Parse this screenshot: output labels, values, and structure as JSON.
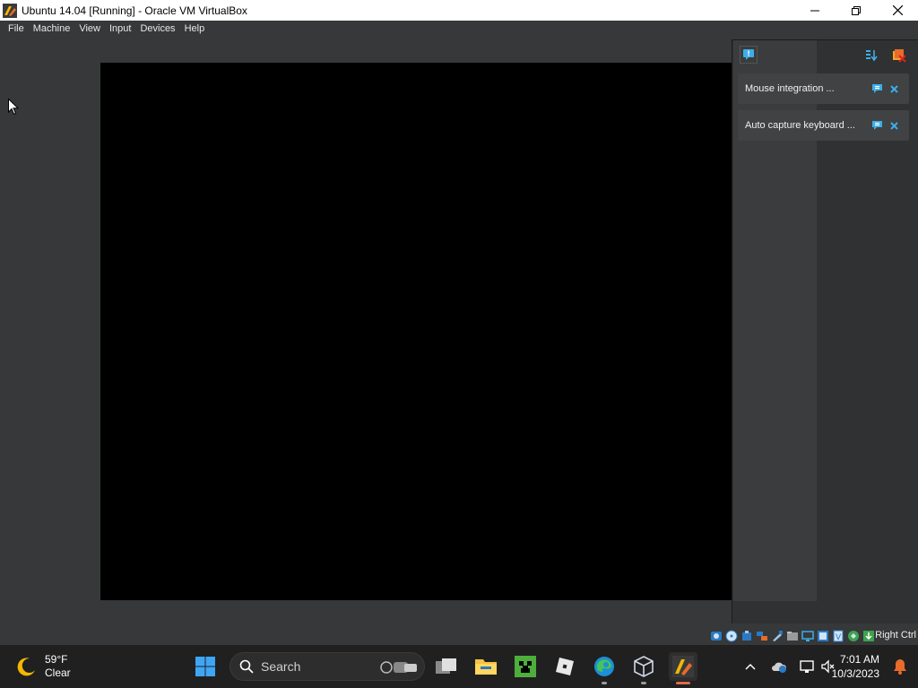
{
  "window": {
    "title": "Ubuntu 14.04 [Running] - Oracle VM VirtualBox",
    "controls": {
      "minimize": "minimize-icon",
      "maximize": "maximize-icon",
      "close": "close-icon"
    }
  },
  "menubar": {
    "items": [
      "File",
      "Machine",
      "View",
      "Input",
      "Devices",
      "Help"
    ]
  },
  "notifications": {
    "items": [
      {
        "text": "Mouse integration ..."
      },
      {
        "text": "Auto capture keyboard ..."
      }
    ]
  },
  "statusbar": {
    "host_key": "Right Ctrl",
    "icons": [
      "hard-disk-icon",
      "optical-drive-icon",
      "audio-icon",
      "network-icon",
      "usb-icon",
      "shared-folders-icon",
      "display-icon",
      "video-capture-icon",
      "mouse-integration-icon",
      "keyboard-icon",
      "arrow-down-icon"
    ]
  },
  "taskbar": {
    "weather": {
      "temp": "59°F",
      "condition": "Clear"
    },
    "search_placeholder": "Search",
    "apps": [
      "start",
      "search",
      "task-view",
      "file-explorer",
      "minecraft",
      "roblox",
      "edge",
      "virtualbox",
      "virtualbox-vm"
    ],
    "clock": {
      "time": "7:01 AM",
      "date": "10/3/2023"
    }
  },
  "colors": {
    "menubar_bg": "#363839",
    "vm_screen": "#000000",
    "taskbar_bg": "#202020",
    "accent_blue": "#3daee9"
  }
}
